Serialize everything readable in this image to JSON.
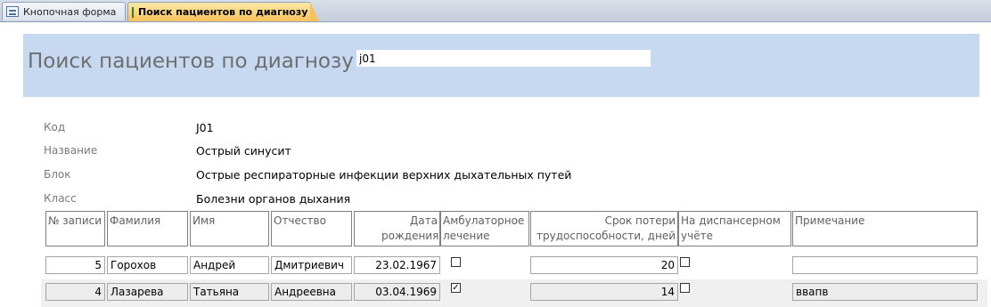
{
  "tabs": [
    {
      "label": "Кнопочная форма",
      "icon": "form-icon"
    },
    {
      "label": "Поиск пациентов по диагнозу",
      "icon": "form-icon"
    }
  ],
  "header": {
    "title": "Поиск пациентов по диагнозу",
    "search_value": "j01"
  },
  "details": [
    {
      "label": "Код",
      "value": "J01"
    },
    {
      "label": "Название",
      "value": "Острый синусит"
    },
    {
      "label": "Блок",
      "value": "Острые респираторные инфекции верхних дыхательных путей"
    },
    {
      "label": "Класс",
      "value": "Болезни органов дыхания"
    }
  ],
  "columns": [
    "№ записи",
    "Фамилия",
    "Имя",
    "Отчество",
    "Дата рождения",
    "Амбулаторное лечение",
    "Срок потери трудоспособности, дней",
    "На диспансерном учёте",
    "Примечание"
  ],
  "rows": [
    {
      "id": "5",
      "surname": "Горохов",
      "name": "Андрей",
      "patronymic": "Дмитриевич",
      "birth_date": "23.02.1967",
      "outpatient": false,
      "sick_days": "20",
      "dispensary": false,
      "note": ""
    },
    {
      "id": "4",
      "surname": "Лазарева",
      "name": "Татьяна",
      "patronymic": "Андреевна",
      "birth_date": "03.04.1969",
      "outpatient": true,
      "sick_days": "14",
      "dispensary": false,
      "note": "ввапв"
    }
  ],
  "colors": {
    "header_band": "#c6d9f1",
    "active_tab": "#f7c25a",
    "tabbar": "#c5ceda"
  }
}
